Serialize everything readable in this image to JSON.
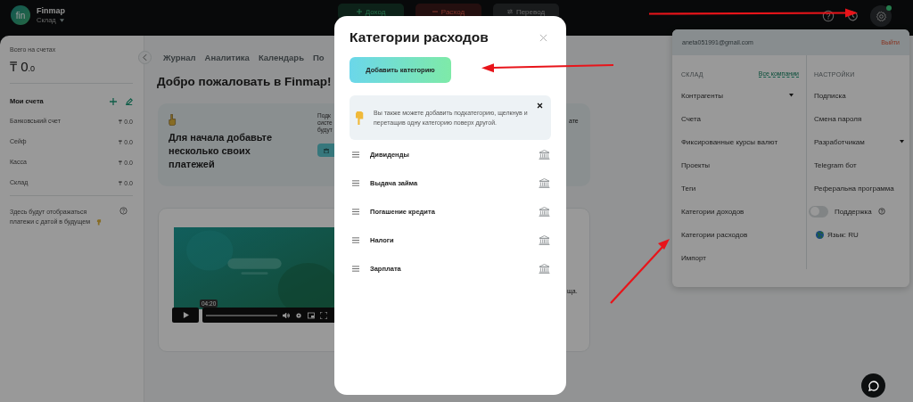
{
  "topbar": {
    "logo": "fin",
    "brand": "Finmap",
    "company": "Склад",
    "notification": true,
    "actions": [
      {
        "label": "Доход",
        "kind": "income"
      },
      {
        "label": "Расход",
        "kind": "expense"
      },
      {
        "label": "Перевод",
        "kind": "transfer"
      }
    ]
  },
  "sidebar": {
    "total_label": "Всего на счетах",
    "total": "₸ 0",
    "total_fraction": ".0",
    "accounts_title": "Мои счета",
    "accounts": [
      {
        "name": "Банковський счет",
        "amount": "₸ 0.0"
      },
      {
        "name": "Сейф",
        "amount": "₸ 0.0"
      },
      {
        "name": "Касса",
        "amount": "₸ 0.0"
      },
      {
        "name": "Склад",
        "amount": "₸ 0.0"
      }
    ],
    "future_note": "Здесь будут отображаться платежи с датой в будущем"
  },
  "main": {
    "tabs": [
      {
        "label": "Журнал"
      },
      {
        "label": "Аналитика"
      },
      {
        "label": "Календарь"
      },
      {
        "label": "По"
      }
    ],
    "heading": "Добро пожаловать в Finmap!",
    "intro_card": {
      "title": "Для начала добавьте несколько своих платежей",
      "side_lines": [
        "Подк",
        "систе",
        "будут"
      ],
      "right_fragment": "ате"
    },
    "video_card": {
      "time": "04:20",
      "right_fragment": "ща."
    }
  },
  "dropdown": {
    "email": "aneta051991@gmail.com",
    "logout": "Выйти",
    "section": "СКЛАД",
    "all_companies": "Все компании",
    "items": [
      {
        "label": "Контрагенты",
        "kind": "submenu"
      },
      {
        "label": "Счета",
        "kind": "link"
      },
      {
        "label": "Фиксированные курсы валют",
        "kind": "link"
      },
      {
        "label": "Проекты",
        "kind": "link"
      },
      {
        "label": "Теги",
        "kind": "link"
      },
      {
        "label": "Категории доходов",
        "kind": "link"
      },
      {
        "label": "Категории расходов",
        "kind": "link"
      },
      {
        "label": "Импорт",
        "kind": "link"
      }
    ],
    "settings_title": "НАСТРОЙКИ",
    "settings": [
      {
        "label": "Подписка",
        "kind": "link"
      },
      {
        "label": "Смена пароля",
        "kind": "link"
      },
      {
        "label": "Разработчикам",
        "kind": "submenu"
      },
      {
        "label": "Telegram бот",
        "kind": "link"
      },
      {
        "label": "Реферальна программа",
        "kind": "link"
      },
      {
        "label": "Поддержка",
        "kind": "toggle",
        "on": false
      },
      {
        "label": "Язык: RU",
        "kind": "language"
      }
    ]
  },
  "modal": {
    "title": "Категории расходов",
    "add_button": "Добавить категорию",
    "hint": "Вы также можете добавить подкатегорию, щелкнув и перетащив одну категорию поверх другой.",
    "categories": [
      {
        "name": "Дивиденды"
      },
      {
        "name": "Выдача займа"
      },
      {
        "name": "Погашение кредита"
      },
      {
        "name": "Налоги"
      },
      {
        "name": "Зарплата"
      }
    ]
  }
}
